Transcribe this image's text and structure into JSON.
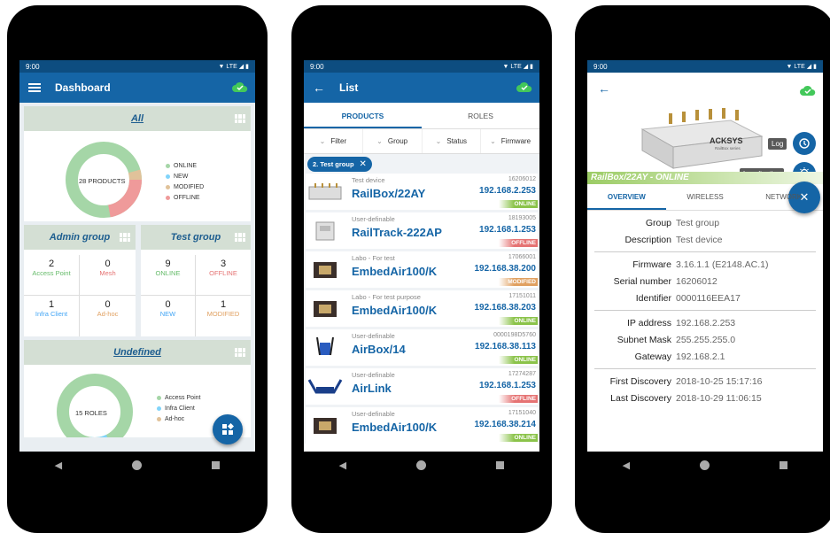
{
  "status_time": "9:00",
  "status_net": "LTE",
  "screen1": {
    "title": "Dashboard",
    "all_card": {
      "title": "All",
      "center_label": "28 PRODUCTS",
      "legend": [
        {
          "label": "ONLINE",
          "color": "#a5d6a7"
        },
        {
          "label": "NEW",
          "color": "#81d4fa"
        },
        {
          "label": "MODIFIED",
          "color": "#e0c29a"
        },
        {
          "label": "OFFLINE",
          "color": "#ef9a9a"
        }
      ]
    },
    "admin_group": {
      "title": "Admin group",
      "stats": [
        {
          "n": "2",
          "l": "Access Point",
          "c": "#66bb6a"
        },
        {
          "n": "0",
          "l": "Mesh",
          "c": "#e57373"
        },
        {
          "n": "1",
          "l": "Infra Client",
          "c": "#42a5f5"
        },
        {
          "n": "0",
          "l": "Ad-hoc",
          "c": "#e0a060"
        }
      ]
    },
    "test_group": {
      "title": "Test group",
      "stats": [
        {
          "n": "9",
          "l": "ONLINE",
          "c": "#66bb6a"
        },
        {
          "n": "3",
          "l": "OFFLINE",
          "c": "#e57373"
        },
        {
          "n": "0",
          "l": "NEW",
          "c": "#42a5f5"
        },
        {
          "n": "1",
          "l": "MODIFIED",
          "c": "#e0a060"
        }
      ]
    },
    "undefined_card": {
      "title": "Undefined",
      "center_label": "15 ROLES",
      "legend": [
        {
          "label": "Access Point",
          "color": "#a5d6a7"
        },
        {
          "label": "Infra Client",
          "color": "#81d4fa"
        },
        {
          "label": "Ad-hoc",
          "color": "#e0c29a"
        }
      ]
    }
  },
  "screen2": {
    "title": "List",
    "tabs": [
      "PRODUCTS",
      "ROLES"
    ],
    "filters": [
      "Filter",
      "Group",
      "Status",
      "Firmware"
    ],
    "chip": "2. Test group",
    "rows": [
      {
        "sub": "Test device",
        "name": "RailBox/22AY",
        "serial": "16206012",
        "ip": "192.168.2.253",
        "status": "ONLINE",
        "color": "#8bc34a"
      },
      {
        "sub": "User-definable",
        "name": "RailTrack-222AP",
        "serial": "18193005",
        "ip": "192.168.1.253",
        "status": "OFFLINE",
        "color": "#e57373"
      },
      {
        "sub": "Labo - For test",
        "name": "EmbedAir100/K",
        "serial": "17066001",
        "ip": "192.168.38.200",
        "status": "MODIFIED",
        "color": "#e0a060"
      },
      {
        "sub": "Labo - For test purpose",
        "name": "EmbedAir100/K",
        "serial": "17151011",
        "ip": "192.168.38.203",
        "status": "ONLINE",
        "color": "#8bc34a"
      },
      {
        "sub": "User-definable",
        "name": "AirBox/14",
        "serial": "0000198D5760",
        "ip": "192.168.38.113",
        "status": "ONLINE",
        "color": "#8bc34a"
      },
      {
        "sub": "User-definable",
        "name": "AirLink",
        "serial": "17274287",
        "ip": "192.168.1.253",
        "status": "OFFLINE",
        "color": "#e57373"
      },
      {
        "sub": "User-definable",
        "name": "EmbedAir100/K",
        "serial": "17151040",
        "ip": "192.168.38.214",
        "status": "ONLINE",
        "color": "#8bc34a"
      }
    ]
  },
  "screen3": {
    "caption": "RailBox/22AY - ONLINE",
    "brand": "ACKSYS",
    "device_label": "RailBox series",
    "tooltip_log": "Log",
    "tooltip_loc": "Localisation",
    "tabs": [
      "OVERVIEW",
      "WIRELESS",
      "NETWORK"
    ],
    "groups": [
      [
        {
          "k": "Group",
          "v": "Test group"
        },
        {
          "k": "Description",
          "v": "Test device"
        }
      ],
      [
        {
          "k": "Firmware",
          "v": "3.16.1.1 (E2148.AC.1)"
        },
        {
          "k": "Serial number",
          "v": "16206012"
        },
        {
          "k": "Identifier",
          "v": "0000116EEA17"
        }
      ],
      [
        {
          "k": "IP address",
          "v": "192.168.2.253"
        },
        {
          "k": "Subnet Mask",
          "v": "255.255.255.0"
        },
        {
          "k": "Gateway",
          "v": "192.168.2.1"
        }
      ],
      [
        {
          "k": "First Discovery",
          "v": "2018-10-25 15:17:16"
        },
        {
          "k": "Last Discovery",
          "v": "2018-10-29 11:06:15"
        }
      ]
    ]
  }
}
